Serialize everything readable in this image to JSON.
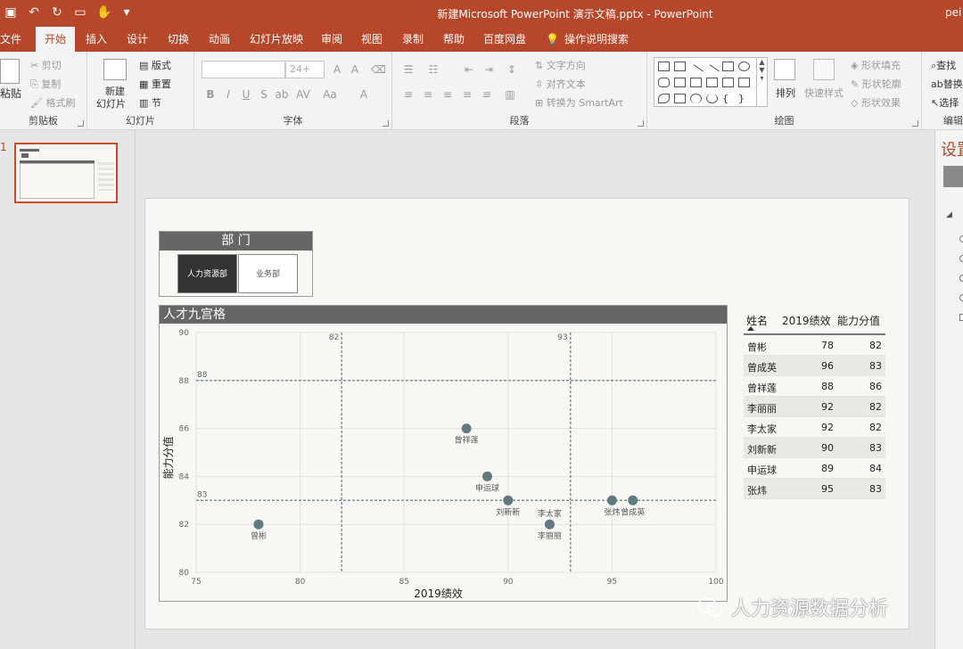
{
  "window": {
    "title": "新建Microsoft PowerPoint 演示文稿.pptx  -  PowerPoint",
    "user": "pei"
  },
  "tabs": [
    "文件",
    "开始",
    "插入",
    "设计",
    "切换",
    "动画",
    "幻灯片放映",
    "审阅",
    "视图",
    "录制",
    "帮助",
    "百度网盘",
    "操作说明搜索"
  ],
  "ribbon": {
    "clipboard": {
      "label": "剪贴板",
      "paste": "粘贴",
      "cut": "剪切",
      "copy": "复制",
      "format_painter": "格式刷"
    },
    "slides": {
      "label": "幻灯片",
      "new_slide": "新建",
      "new_slide2": "幻灯片",
      "layout": "版式",
      "reset": "重置",
      "section": "节"
    },
    "font": {
      "label": "字体",
      "size": "24+"
    },
    "paragraph": {
      "label": "段落",
      "text_direction": "文字方向",
      "align_text": "对齐文本",
      "smartart": "转换为 SmartArt"
    },
    "drawing": {
      "label": "绘图",
      "arrange": "排列",
      "quick_styles": "快速样式",
      "shape_fill": "形状填充",
      "shape_outline": "形状轮廓",
      "shape_effects": "形状效果"
    },
    "editing": {
      "label": "编辑",
      "find": "查找",
      "replace": "替换",
      "select": "选择"
    }
  },
  "thumbnail": {
    "number": "1"
  },
  "slide": {
    "dept_slicer": {
      "title": "部  门",
      "options": [
        "人力资源部",
        "业务部"
      ],
      "selected": "人力资源部"
    },
    "chart_title": "人才九宫格",
    "table": {
      "headers": [
        "姓名",
        "2019绩效",
        "能力分值"
      ],
      "rows": [
        [
          "曾彬",
          "78",
          "82"
        ],
        [
          "曾成英",
          "96",
          "83"
        ],
        [
          "曾祥莲",
          "88",
          "86"
        ],
        [
          "李丽丽",
          "92",
          "82"
        ],
        [
          "李太家",
          "92",
          "82"
        ],
        [
          "刘新新",
          "90",
          "83"
        ],
        [
          "申运球",
          "89",
          "84"
        ],
        [
          "张炜",
          "95",
          "83"
        ]
      ]
    }
  },
  "chart_data": {
    "type": "scatter",
    "title": "人才九宫格",
    "xlabel": "2019绩效",
    "ylabel": "能力分值",
    "xlim": [
      75,
      100
    ],
    "ylim": [
      80,
      90
    ],
    "xticks": [
      75,
      80,
      85,
      90,
      95,
      100
    ],
    "yticks": [
      80,
      82,
      84,
      86,
      88,
      90
    ],
    "grid": true,
    "point_color": "#5f7a80",
    "reference_lines": [
      {
        "axis": "x",
        "value": 82,
        "label": "82"
      },
      {
        "axis": "x",
        "value": 93,
        "label": "93"
      },
      {
        "axis": "y",
        "value": 88,
        "label": "88"
      },
      {
        "axis": "y",
        "value": 83,
        "label": "83"
      }
    ],
    "points": [
      {
        "name": "曾彬",
        "x": 78,
        "y": 82
      },
      {
        "name": "曾成英",
        "x": 96,
        "y": 83
      },
      {
        "name": "曾祥莲",
        "x": 88,
        "y": 86
      },
      {
        "name": "李丽丽",
        "x": 92,
        "y": 82
      },
      {
        "name": "李太家",
        "x": 92,
        "y": 82
      },
      {
        "name": "刘新新",
        "x": 90,
        "y": 83
      },
      {
        "name": "申运球",
        "x": 89,
        "y": 84
      },
      {
        "name": "张炜",
        "x": 95,
        "y": 83
      }
    ]
  },
  "watermark": "人力资源数据分析",
  "right_pane": {
    "title": "设置"
  },
  "colors": {
    "accent": "#b7472a",
    "header_gray": "#666666",
    "slide_bg": "#f8f7f3"
  }
}
